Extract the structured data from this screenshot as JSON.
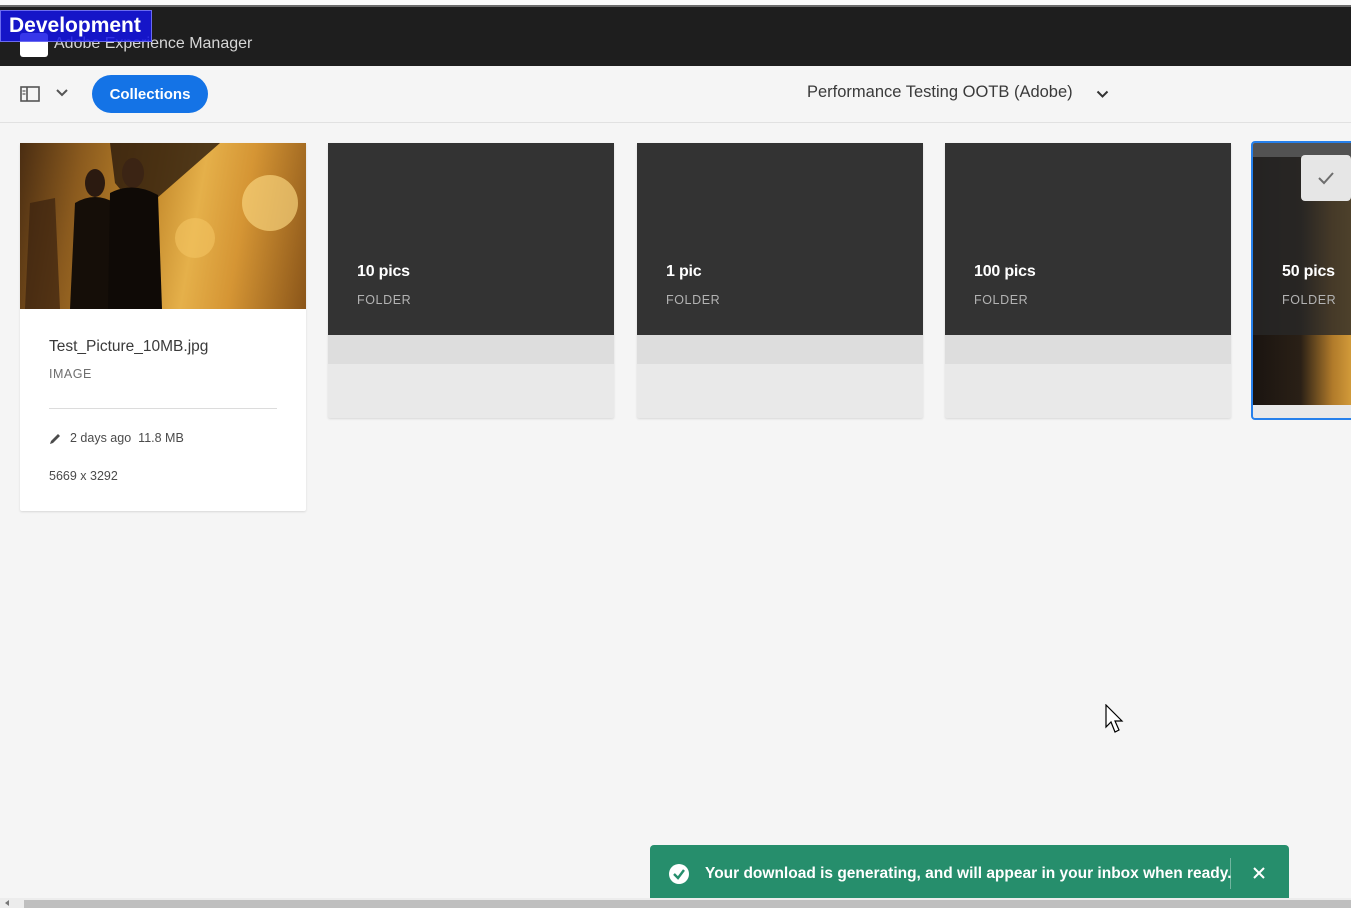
{
  "window": {
    "app_name": "Adobe Experience Manager",
    "env_badge": "Development"
  },
  "toolbar": {
    "collections_label": "Collections",
    "breadcrumb_title": "Performance Testing OOTB (Adobe)"
  },
  "asset": {
    "name": "Test_Picture_10MB.jpg",
    "type": "IMAGE",
    "modified": "2 days ago",
    "size": "11.8 MB",
    "dimensions": "5669 x 3292"
  },
  "folders": [
    {
      "title": "10 pics",
      "type": "FOLDER"
    },
    {
      "title": "1 pic",
      "type": "FOLDER"
    },
    {
      "title": "100 pics",
      "type": "FOLDER"
    },
    {
      "title": "50 pics",
      "type": "FOLDER",
      "selected": true
    }
  ],
  "toast": {
    "message": "Your download is generating, and will appear in your inbox when ready.",
    "status": "success"
  },
  "colors": {
    "accent": "#1473e6",
    "toast_success": "#268e6c",
    "selection": "#2680eb"
  }
}
